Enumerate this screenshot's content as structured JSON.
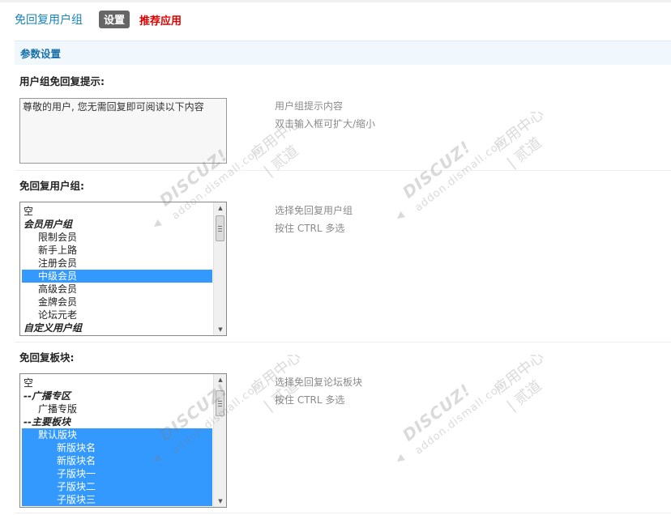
{
  "header": {
    "title": "免回复用户组",
    "tab_settings": "设置",
    "tab_recommend": "推荐应用"
  },
  "section": {
    "title": "参数设置"
  },
  "field_tip": {
    "label": "用户组免回复提示:",
    "value": "尊敬的用户, 您无需回复即可阅读以下内容",
    "hint1": "用户组提示内容",
    "hint2": "双击输入框可扩大/缩小"
  },
  "field_groups": {
    "label": "免回复用户组:",
    "hint1": "选择免回复用户组",
    "hint2": "按住 CTRL 多选",
    "options": [
      {
        "text": "空",
        "kind": "item",
        "level": 0,
        "selected": false
      },
      {
        "text": "会员用户组",
        "kind": "group",
        "level": 0,
        "selected": false
      },
      {
        "text": "限制会员",
        "kind": "item",
        "level": 1,
        "selected": false
      },
      {
        "text": "新手上路",
        "kind": "item",
        "level": 1,
        "selected": false
      },
      {
        "text": "注册会员",
        "kind": "item",
        "level": 1,
        "selected": false
      },
      {
        "text": "中级会员",
        "kind": "item",
        "level": 1,
        "selected": true
      },
      {
        "text": "高级会员",
        "kind": "item",
        "level": 1,
        "selected": false
      },
      {
        "text": "金牌会员",
        "kind": "item",
        "level": 1,
        "selected": false
      },
      {
        "text": "论坛元老",
        "kind": "item",
        "level": 1,
        "selected": false
      },
      {
        "text": "自定义用户组",
        "kind": "group",
        "level": 0,
        "selected": false
      }
    ]
  },
  "field_forums": {
    "label": "免回复板块:",
    "hint1": "选择免回复论坛板块",
    "hint2": "按住 CTRL 多选",
    "options": [
      {
        "text": "空",
        "kind": "item",
        "level": 0,
        "selected": false
      },
      {
        "text": "--广播专区",
        "kind": "group",
        "level": 0,
        "selected": false
      },
      {
        "text": "广播专版",
        "kind": "item",
        "level": 1,
        "selected": false
      },
      {
        "text": "--主要板块",
        "kind": "group",
        "level": 0,
        "selected": false
      },
      {
        "text": "默认版块",
        "kind": "item",
        "level": 1,
        "selected": true
      },
      {
        "text": "新版块名",
        "kind": "item",
        "level": 2,
        "selected": true
      },
      {
        "text": "新版块名",
        "kind": "item",
        "level": 2,
        "selected": true
      },
      {
        "text": "子版块一",
        "kind": "item",
        "level": 2,
        "selected": true
      },
      {
        "text": "子版块二",
        "kind": "item",
        "level": 2,
        "selected": true
      },
      {
        "text": "子版块三",
        "kind": "item",
        "level": 2,
        "selected": true
      }
    ]
  },
  "watermark": {
    "brand": "DISCUZ!",
    "cn": "应用中心 | 贰道",
    "url": "addon.dismall.com"
  },
  "colors": {
    "title": "#1a84b6",
    "recommend": "#dd0000",
    "selected": "#3399ff",
    "section_bg": "#f0f7fd"
  }
}
